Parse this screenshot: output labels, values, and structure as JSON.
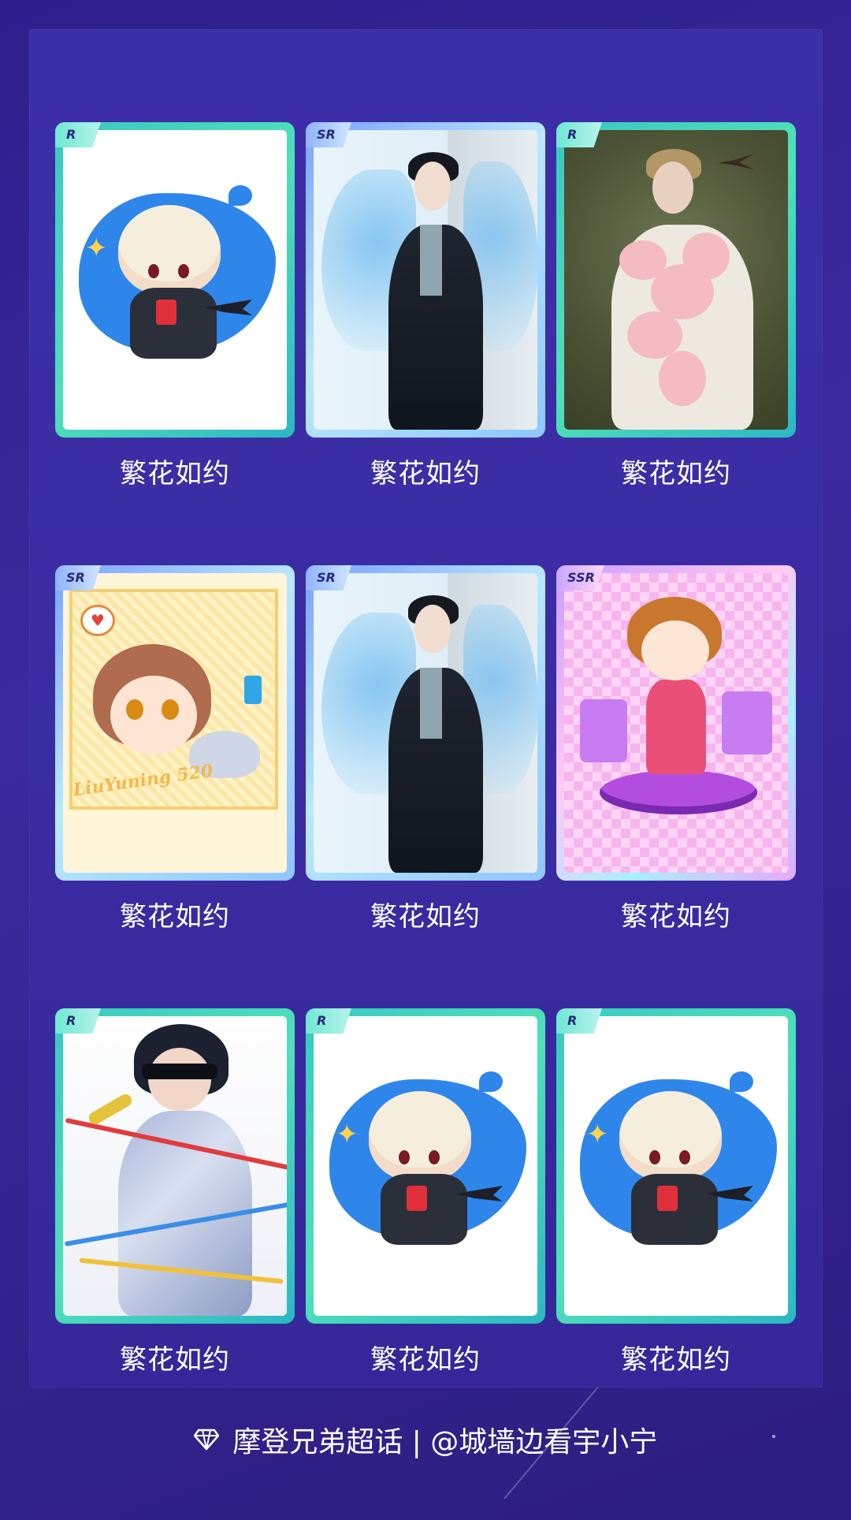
{
  "cards": [
    {
      "rarity": "R",
      "title": "繁花如约",
      "art": "chibi-white"
    },
    {
      "rarity": "SR",
      "title": "繁花如约",
      "art": "butterfly"
    },
    {
      "rarity": "R",
      "title": "繁花如约",
      "art": "blossom"
    },
    {
      "rarity": "SR",
      "title": "繁花如约",
      "art": "yellow"
    },
    {
      "rarity": "SR",
      "title": "繁花如约",
      "art": "butterfly"
    },
    {
      "rarity": "SSR",
      "title": "繁花如约",
      "art": "pink"
    },
    {
      "rarity": "R",
      "title": "繁花如约",
      "art": "mic"
    },
    {
      "rarity": "R",
      "title": "繁花如约",
      "art": "chibi-white"
    },
    {
      "rarity": "R",
      "title": "繁花如约",
      "art": "chibi-white"
    }
  ],
  "yellow_art_text": "LiuYuning 520",
  "footer": {
    "icon": "diamond-icon",
    "text": "摩登兄弟超话 | @城墙边看宇小宁"
  },
  "colors": {
    "background": "#2e1f8c",
    "panel": "#3d2fa8",
    "r_frame": "#39c9c0",
    "sr_frame": "#8ec6ff",
    "ssr_frame": "#ffc9f2"
  }
}
